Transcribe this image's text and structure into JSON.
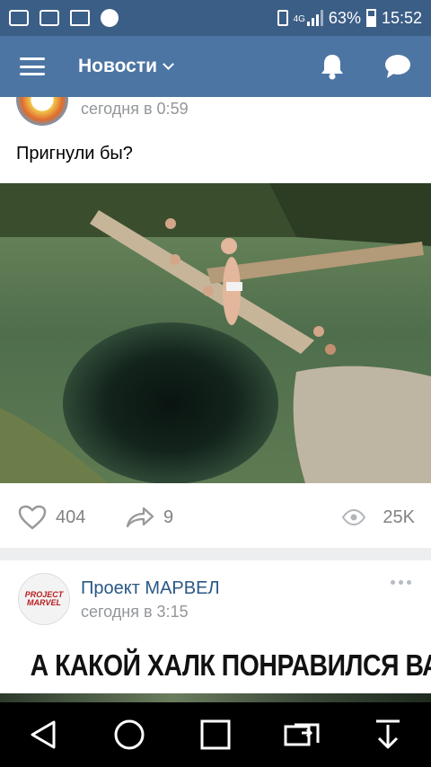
{
  "status_bar": {
    "network": "4G",
    "battery": "63%",
    "time": "15:52"
  },
  "header": {
    "title": "Новости"
  },
  "posts": [
    {
      "time": "сегодня в 0:59",
      "text": "Пригнули бы?",
      "likes": "404",
      "shares": "9",
      "views": "25K"
    },
    {
      "author": "Проект МАРВЕЛ",
      "avatar_text": "PROJECT MARVEL",
      "time": "сегодня в 3:15",
      "headline": "А КАКОЙ ХАЛК ПОНРАВИЛСЯ ВАМ?"
    }
  ],
  "icons": {
    "menu": "hamburger-icon",
    "dropdown": "chevron-down-icon",
    "notifications": "bell-icon",
    "messages": "chat-bubble-icon",
    "like": "heart-icon",
    "share": "share-arrow-icon",
    "views": "eye-icon",
    "more": "more-dots-icon"
  },
  "colors": {
    "status_bar": "#3b5e86",
    "app_bar": "#4c75a3",
    "link": "#2a5885",
    "meta": "#939699"
  }
}
